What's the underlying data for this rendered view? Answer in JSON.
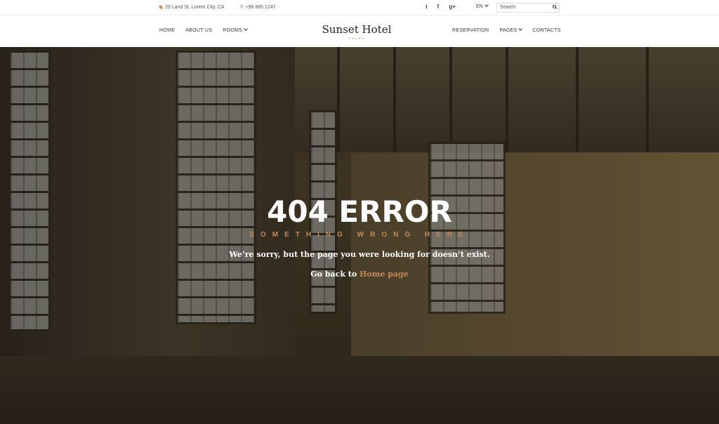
{
  "topbar": {
    "address": "29 Land St, Lorem City, CA",
    "phone": "+96 885 1247",
    "social": {
      "twitter": "t",
      "facebook": "f",
      "googleplus": "g+"
    },
    "lang": "EN",
    "search_placeholder": "Search"
  },
  "nav": {
    "left": [
      {
        "label": "HOME"
      },
      {
        "label": "ABOUT US"
      },
      {
        "label": "ROOMS"
      }
    ],
    "right": [
      {
        "label": "RESERVATION"
      },
      {
        "label": "PAGES"
      },
      {
        "label": "CONTACTS"
      }
    ]
  },
  "logo": {
    "name": "Sunset Hotel",
    "tagline": "GRAND"
  },
  "error": {
    "title": "404 ERROR",
    "subtitle": "SOMETHING WRONG HERE",
    "message": "We’re sorry, but the page you were looking for doesn’t exist.",
    "back_prefix": "Go back to ",
    "back_link": "Home page"
  },
  "colors": {
    "accent": "#c48a5a",
    "text": "#333333",
    "white": "#ffffff"
  }
}
